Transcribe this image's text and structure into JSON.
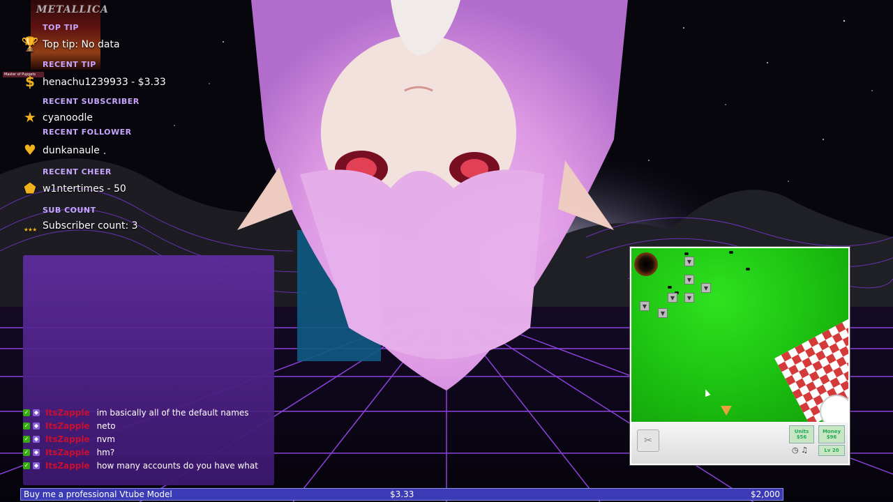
{
  "overlay": {
    "album_art": {
      "title": "METALLICA",
      "tag": "Master of Puppets"
    },
    "stats": [
      {
        "heading": "TOP TIP",
        "value": "Top tip: No data",
        "icon": "trophy-icon"
      },
      {
        "heading": "RECENT TIP",
        "value": "henachu1239933 - $3.33",
        "icon": "dollar-icon"
      },
      {
        "heading": "RECENT SUBSCRIBER",
        "value": "cyanoodle",
        "icon": "star-icon"
      },
      {
        "heading": "RECENT FOLLOWER",
        "value": "dunkanaule",
        "icon": "heart-icon"
      },
      {
        "heading": "RECENT CHEER",
        "value": "w1ntertimes - 50",
        "icon": "gem-icon"
      },
      {
        "heading": "SUB COUNT",
        "value": "Subscriber count: 3",
        "icon": "stars-icon"
      }
    ],
    "colors": {
      "accent": "#c7a6ff",
      "icon": "#f2b21d",
      "chat_user": "#c8102e",
      "bar": "#3b3bb5"
    }
  },
  "chat": {
    "messages": [
      {
        "user": "ItsZapple",
        "text": "im basically all of the default names"
      },
      {
        "user": "ItsZapple",
        "text": "neto"
      },
      {
        "user": "ItsZapple",
        "text": "nvm"
      },
      {
        "user": "ItsZapple",
        "text": "hm?"
      },
      {
        "user": "ItsZapple",
        "text": "how many accounts do you have what"
      }
    ]
  },
  "game": {
    "units_label": "Units",
    "units_value": "$56",
    "money_label": "Money",
    "money_value": "$96",
    "level": "Lv 20"
  },
  "donation_goal": {
    "label": "Buy me a professional Vtube Model",
    "current": "$3.33",
    "target": "$2,000",
    "progress_fraction": 0.0017
  }
}
